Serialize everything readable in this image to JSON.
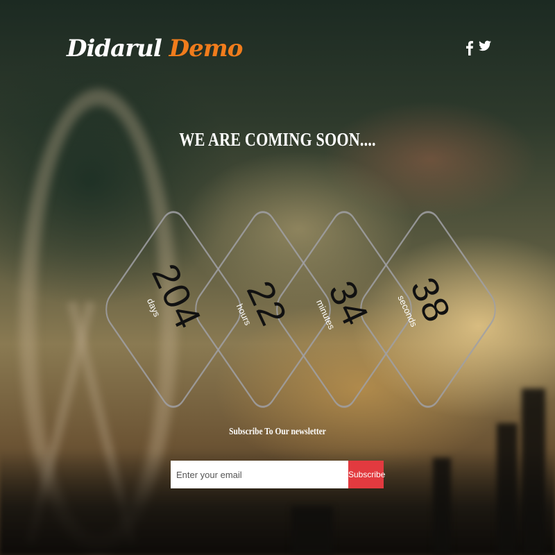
{
  "brand": {
    "name_main": "Didarul",
    "name_accent": "Demo",
    "accent_color": "#f07c1c"
  },
  "social": [
    {
      "icon": "facebook-icon",
      "label": "f"
    },
    {
      "icon": "twitter-icon",
      "label": "twitter"
    }
  ],
  "headline": "WE ARE COMING SOON....",
  "countdown": [
    {
      "value": "204",
      "unit": "days"
    },
    {
      "value": "22",
      "unit": "hours"
    },
    {
      "value": "34",
      "unit": "minutes"
    },
    {
      "value": "38",
      "unit": "seconds"
    }
  ],
  "newsletter": {
    "title": "Subscribe To Our newsletter",
    "placeholder": "Enter your email",
    "button_label": "Subscribe",
    "button_color": "#e23a3f"
  }
}
